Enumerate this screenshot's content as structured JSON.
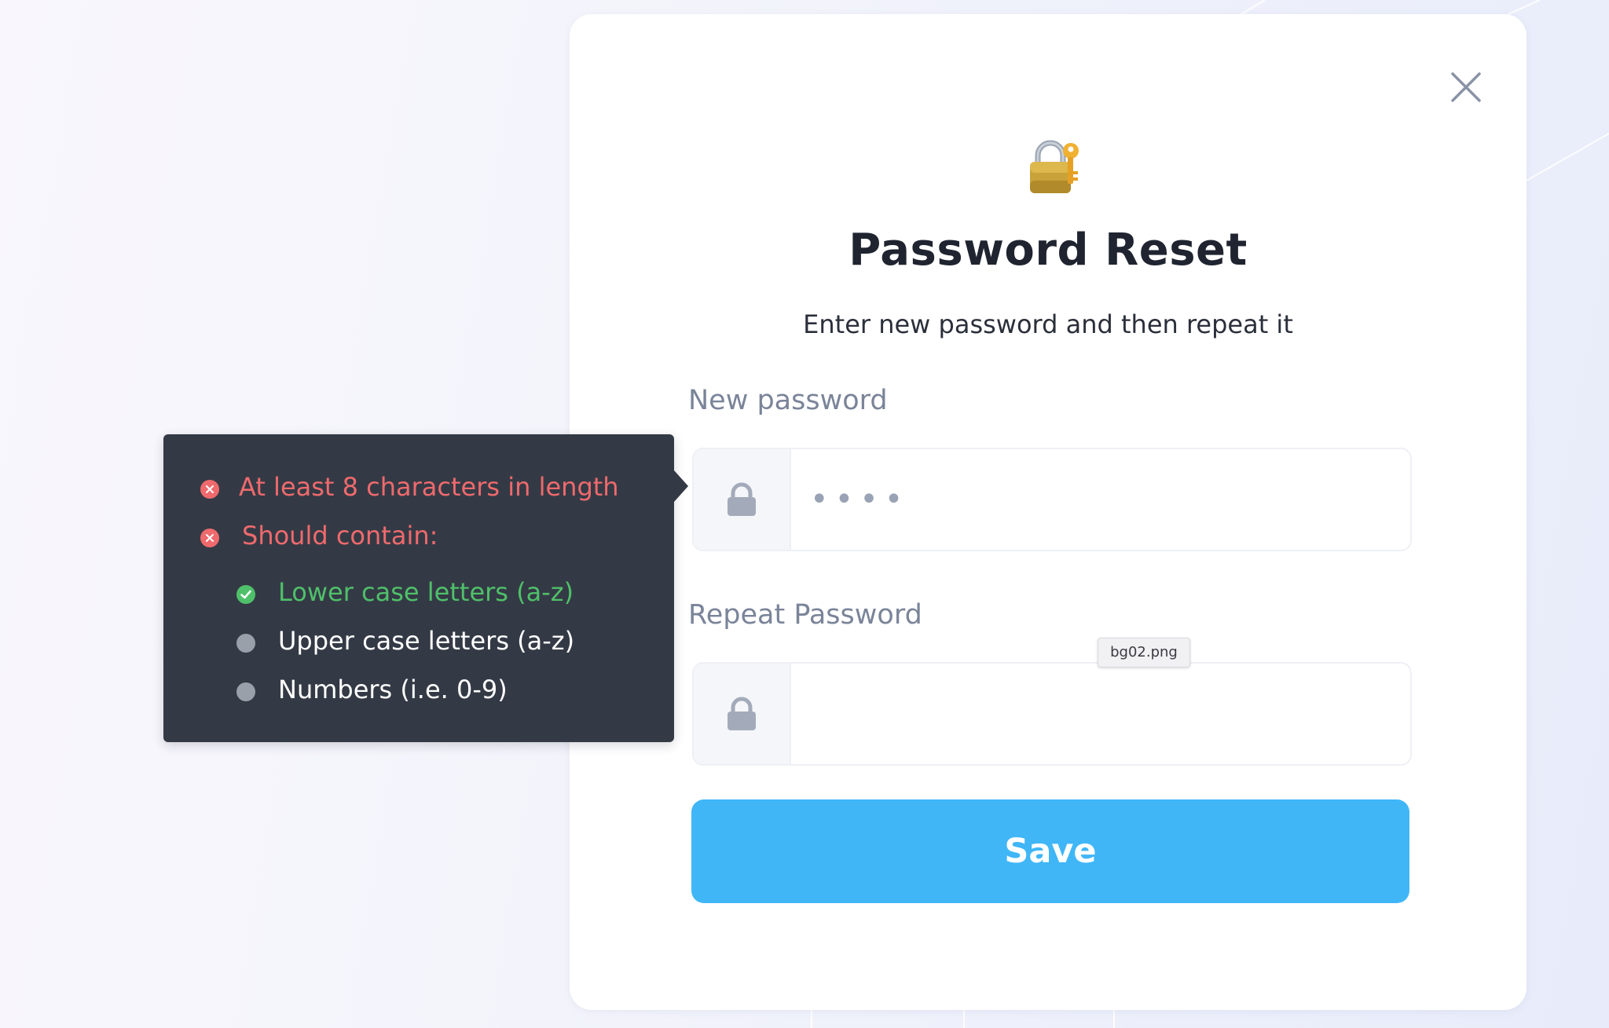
{
  "modal": {
    "title": "Password Reset",
    "subtitle": "Enter new password and then repeat it",
    "new_password": {
      "label": "New password",
      "value": "••••"
    },
    "repeat_password": {
      "label": "Repeat Password",
      "value": ""
    },
    "save_label": "Save",
    "file_tag": "bg02.png"
  },
  "requirements": {
    "min_length": {
      "text": "At least 8 characters in length",
      "status": "fail"
    },
    "contain": {
      "text": "Should contain:",
      "status": "fail"
    },
    "lowercase": {
      "text": "Lower case letters (a-z)",
      "status": "pass"
    },
    "uppercase": {
      "text": "Upper case letters (a-z)",
      "status": "neutral"
    },
    "numbers": {
      "text": "Numbers (i.e. 0-9)",
      "status": "neutral"
    }
  },
  "colors": {
    "accent": "#40b6f7",
    "fail": "#ef6a6d",
    "pass": "#4fc06a",
    "neutral": "#9aa0aa",
    "tooltip_bg": "#343a45"
  },
  "icons": {
    "close": "close-icon",
    "header": "lock-with-key-icon",
    "field": "lock-icon"
  }
}
